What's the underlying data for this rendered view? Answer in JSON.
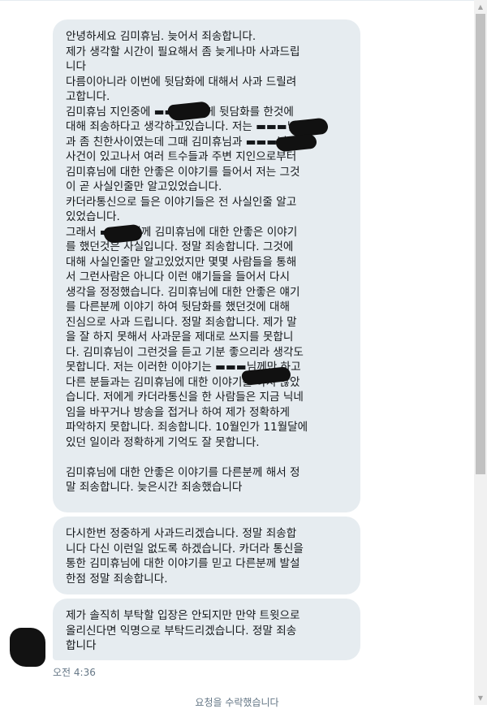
{
  "messages": [
    {
      "lines": [
        "안녕하세요 김미휴님. 늦어서 죄송합니다.",
        "제가 생각할 시간이 필요해서 좀 늦게나마 사과드립",
        "니다",
        "다름이아니라 이번에 뒷담화에 대해서 사과 드릴려",
        "고합니다.",
        "김미휴님 지인중에 ▬▬▬님에게 뒷담화를 한것에",
        "대해 죄송하다고 생각하고있습니다. 저는 ▬▬▬님",
        "과 좀 친한사이였는데 그때 김미휴님과 ▬▬▬님의",
        "사건이 있고나서 여러 트수들과 주변 지인으로부터",
        "김미휴님에 대한 안좋은 이야기를 들어서 저는 그것",
        "이 곧 사실인줄만 알고있었습니다.",
        "카더라통신으로 들은 이야기들은 전 사실인줄 알고",
        "있었습니다.",
        "그래서 ▬▬▬님께 김미휴님에 대한 안좋은 이야기",
        "를 했던것은 사실입니다. 정말 죄송합니다. 그것에",
        "대해 사실인줄만 알고있었지만 몇몇 사람들을 통해",
        "서 그런사람은 아니다 이런 얘기들을 들어서 다시",
        "생각을 정정했습니다. 김미휴님에 대한 안좋은 얘기",
        "를 다른분께 이야기 하여 뒷담화를 했던것에 대해",
        "진심으로 사과 드립니다. 정말 죄송합니다. 제가 말",
        "을 잘 하지 못해서 사과문을 제대로 쓰지를 못합니",
        "다. 김미휴님이 그런것을 듣고 기분 좋으리라 생각도",
        "못합니다. 저는 이러한 이야기는 ▬▬▬님께만 하고",
        "다른 분들과는 김미휴님에 대한 이야기를 하지 않았",
        "습니다. 저에게 카더라통신을 한 사람들은 지금 닉네",
        "임을 바꾸거나 방송을 접거나 하여 제가 정확하게",
        "파악하지 못합니다. 죄송합니다. 10월인가 11월달에",
        "있던 일이라 정확하게 기억도 잘 못합니다.",
        "",
        "김미휴님에 대한 안좋은 이야기를 다른분께 해서 정",
        "말 죄송합니다. 늦은시간 죄송했습니다"
      ]
    },
    {
      "lines": [
        "다시한번 정중하게 사과드리겠습니다. 정말 죄송합",
        "니다 다신 이런일 없도록 하겠습니다. 카더라 통신을",
        "통한 김미휴님에 대한 이야기를 믿고 다른분께 발설",
        "한점 정말 죄송합니다."
      ]
    },
    {
      "lines": [
        "제가 솔직히 부탁할 입장은 안되지만 만약 트윗으로",
        "올리신다면 익명으로 부탁드리겠습니다. 정말 죄송",
        "합니다"
      ]
    }
  ],
  "timestamp": "오전 4:36",
  "footer": "요청을 수락했습니다",
  "colors": {
    "bubble": "#e6ecf0",
    "text": "#14171a",
    "meta": "#657786"
  }
}
